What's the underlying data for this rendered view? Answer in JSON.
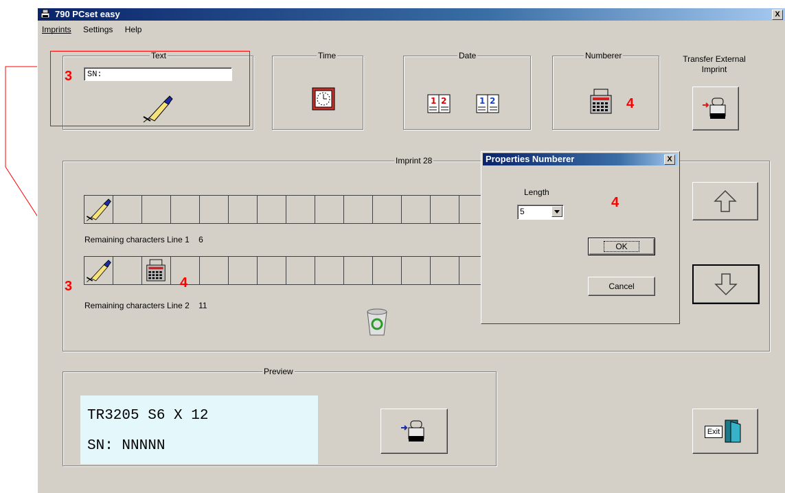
{
  "window": {
    "title": "790 PCset easy",
    "close": "X"
  },
  "menu": {
    "imprints": "Imprints",
    "settings": "Settings",
    "help": "Help"
  },
  "text_group": {
    "label": "Text",
    "value": "SN:"
  },
  "time_group": {
    "label": "Time"
  },
  "date_group": {
    "label": "Date"
  },
  "numberer_group": {
    "label": "Numberer"
  },
  "transfer": {
    "label_line1": "Transfer External",
    "label_line2": "Imprint"
  },
  "imprint_group": {
    "label": "Imprint 28"
  },
  "line1": {
    "label": "Remaining characters Line 1",
    "count": "6"
  },
  "line2": {
    "label": "Remaining characters Line 2",
    "count": "11"
  },
  "preview_group": {
    "label": "Preview",
    "line1": "TR3205 S6 X 12",
    "line2": "SN: NNNNN"
  },
  "exit_label": "Exit",
  "dialog": {
    "title": "Properties Numberer",
    "close": "X",
    "length_label": "Length",
    "length_value": "5",
    "ok": "OK",
    "cancel": "Cancel"
  },
  "annotations": {
    "a3_text": "3",
    "a4_numberer": "4",
    "a4_dialog": "4",
    "a3_line2": "3",
    "a4_line2": "4"
  }
}
